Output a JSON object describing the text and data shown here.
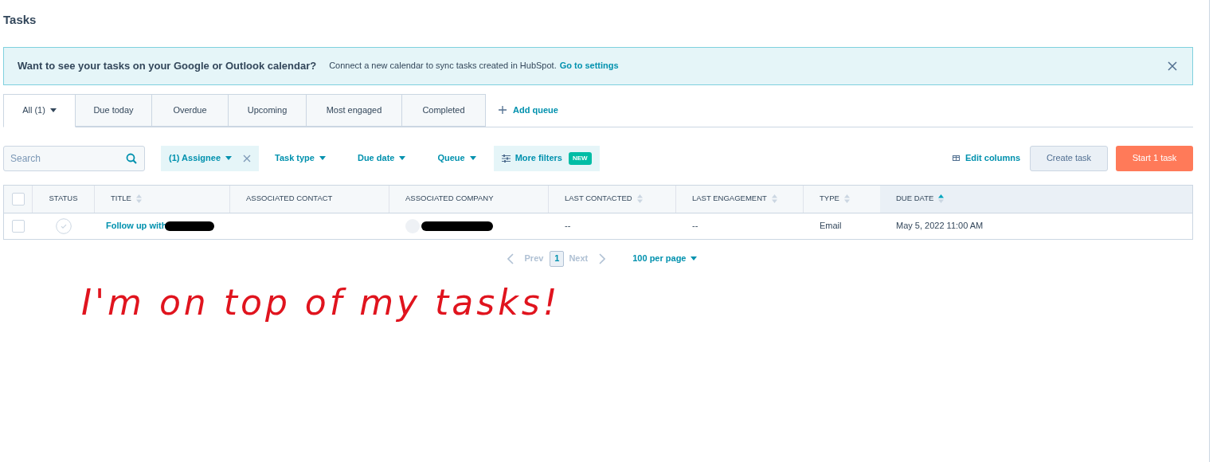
{
  "page_title": "Tasks",
  "banner": {
    "heading": "Want to see your tasks on your Google or Outlook calendar?",
    "text": "Connect a new calendar to sync tasks created in HubSpot.",
    "link": "Go to settings"
  },
  "tabs": [
    {
      "label": "All (1)",
      "selected": true,
      "has_menu": true
    },
    {
      "label": "Due today",
      "selected": false,
      "has_menu": false
    },
    {
      "label": "Overdue",
      "selected": false,
      "has_menu": false
    },
    {
      "label": "Upcoming",
      "selected": false,
      "has_menu": false
    },
    {
      "label": "Most engaged",
      "selected": false,
      "has_menu": false
    },
    {
      "label": "Completed",
      "selected": false,
      "has_menu": false
    }
  ],
  "add_queue": "Add queue",
  "search": {
    "placeholder": "Search"
  },
  "filters": [
    {
      "label": "(1) Assignee",
      "active": true,
      "kind": "dropdown"
    },
    {
      "label": "Task type",
      "active": false,
      "kind": "dropdown"
    },
    {
      "label": "Due date",
      "active": false,
      "kind": "dropdown"
    },
    {
      "label": "Queue",
      "active": false,
      "kind": "dropdown"
    },
    {
      "label": "More filters",
      "active": true,
      "kind": "panel",
      "badge": "NEW"
    }
  ],
  "edit_columns": "Edit columns",
  "create_button": "Create task",
  "start_button": "Start 1 task",
  "table": {
    "all_checked": false,
    "columns": [
      {
        "label": "STATUS",
        "sortable": false,
        "sorted": false
      },
      {
        "label": "TITLE",
        "sortable": true,
        "sorted": false
      },
      {
        "label": "ASSOCIATED CONTACT",
        "sortable": false,
        "sorted": false
      },
      {
        "label": "ASSOCIATED COMPANY",
        "sortable": false,
        "sorted": false
      },
      {
        "label": "LAST CONTACTED",
        "sortable": true,
        "sorted": false
      },
      {
        "label": "LAST ENGAGEMENT",
        "sortable": true,
        "sorted": false
      },
      {
        "label": "TYPE",
        "sortable": true,
        "sorted": false
      },
      {
        "label": "DUE DATE",
        "sortable": true,
        "sorted": true
      }
    ],
    "rows": [
      {
        "checked": false,
        "completed": false,
        "title": "Follow up with",
        "last_contacted": "--",
        "last_engagement": "--",
        "type": "Email",
        "due_date": "May 5, 2022 11:00 AM"
      }
    ]
  },
  "pagination": {
    "prev": "Prev",
    "next": "Next",
    "pages": [
      {
        "label": "1",
        "selected": true
      }
    ],
    "per_page": "100 per page"
  },
  "annotation": "I'm on top of my tasks!"
}
